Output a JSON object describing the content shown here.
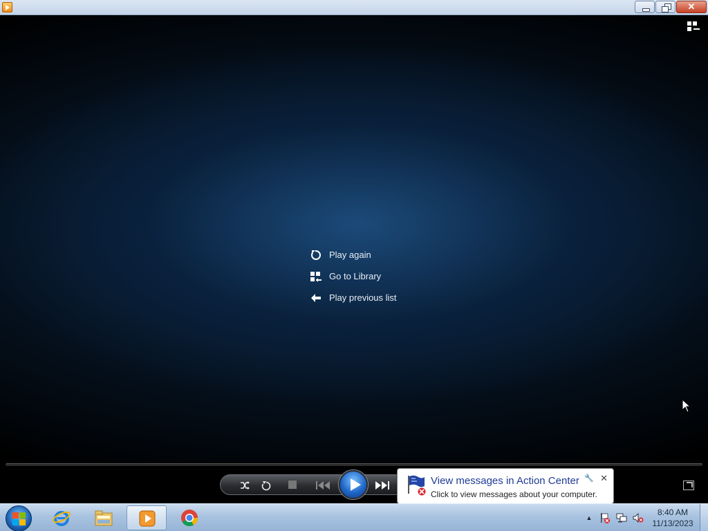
{
  "window": {
    "title": "",
    "close_label": "✕"
  },
  "player": {
    "menu": [
      {
        "label": "Play again",
        "icon": "replay-icon"
      },
      {
        "label": "Go to Library",
        "icon": "library-icon"
      },
      {
        "label": "Play previous list",
        "icon": "back-arrow-icon"
      }
    ]
  },
  "notification": {
    "title": "View messages in Action Center",
    "text": "Click to view messages about your computer.",
    "close_label": "✕",
    "options_label": "🔧"
  },
  "taskbar": {
    "apps": [
      "internet-explorer",
      "windows-explorer",
      "windows-media-player",
      "google-chrome"
    ],
    "clock_time": "8:40 AM",
    "clock_date": "11/13/2023",
    "tray_expand": "▲"
  },
  "colors": {
    "accent": "#1f67c8",
    "taskbar": "#a9c3e0"
  }
}
